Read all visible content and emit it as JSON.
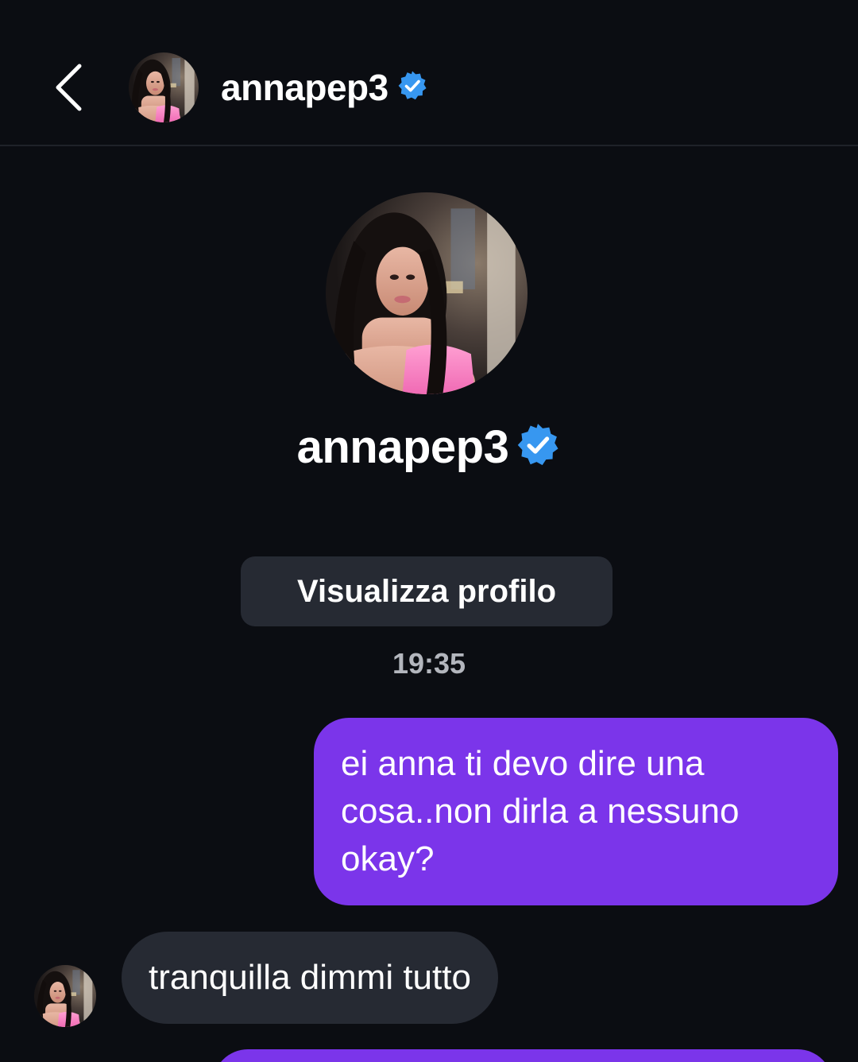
{
  "header": {
    "back_icon": "chevron-left-icon",
    "username": "annapep3",
    "verified_icon": "verified-badge-icon"
  },
  "profile": {
    "username": "annapep3",
    "verified_icon": "verified-badge-icon",
    "view_profile_label": "Visualizza profilo"
  },
  "conversation": {
    "timestamp": "19:35",
    "messages": [
      {
        "direction": "outgoing",
        "text": "ei anna ti devo dire una cosa..non dirla a nessuno okay?"
      },
      {
        "direction": "incoming",
        "text": "tranquilla dimmi tutto"
      }
    ]
  },
  "colors": {
    "background": "#0b0d12",
    "outgoing_bubble": "#7b35ea",
    "incoming_bubble": "#262a33",
    "verified_blue": "#3797f0"
  }
}
